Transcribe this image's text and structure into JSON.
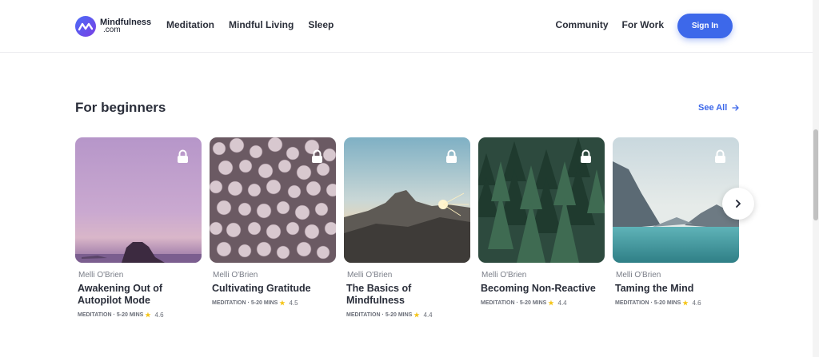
{
  "header": {
    "logo_name": "Mindfulness",
    "logo_sub": ".com",
    "nav_left": [
      "Meditation",
      "Mindful Living",
      "Sleep"
    ],
    "nav_right": [
      "Community",
      "For Work"
    ],
    "signin_label": "Sign In"
  },
  "section": {
    "title": "For beginners",
    "see_all": "See All"
  },
  "cards": [
    {
      "author": "Melli O'Brien",
      "title": "Awakening Out of Autopilot Mode",
      "category": "MEDITATION",
      "duration": "5-20 MINS",
      "rating": "4.6"
    },
    {
      "author": "Melli O'Brien",
      "title": "Cultivating Gratitude",
      "category": "MEDITATION",
      "duration": "5-20 MINS",
      "rating": "4.5"
    },
    {
      "author": "Melli O'Brien",
      "title": "The Basics of Mindfulness",
      "category": "MEDITATION",
      "duration": "5-20 MINS",
      "rating": "4.4"
    },
    {
      "author": "Melli O'Brien",
      "title": "Becoming Non-Reactive",
      "category": "MEDITATION",
      "duration": "5-20 MINS",
      "rating": "4.4"
    },
    {
      "author": "Melli O'Brien",
      "title": "Taming the Mind",
      "category": "MEDITATION",
      "duration": "5-20 MINS",
      "rating": "4.6"
    }
  ],
  "icons": {
    "lock": "lock-icon",
    "next": "chevron-right-icon",
    "arrow": "arrow-right-icon"
  },
  "colors": {
    "accent": "#3d68ea",
    "text": "#2a2e3a",
    "star": "#f5c518"
  }
}
